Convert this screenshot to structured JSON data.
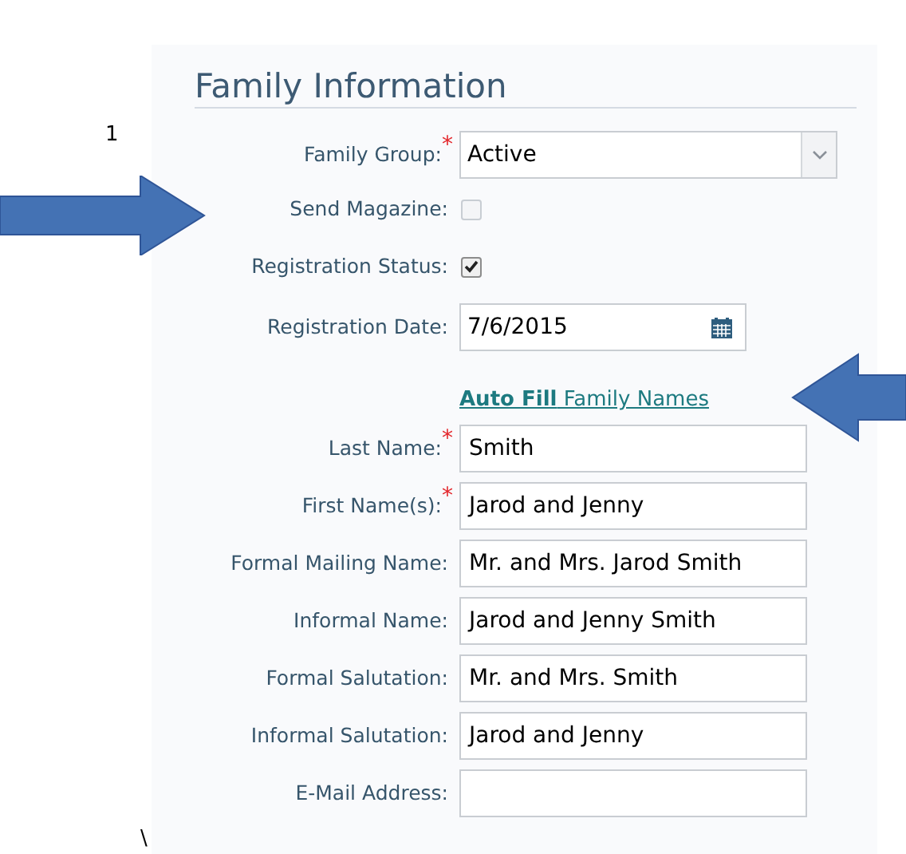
{
  "page_number": "1",
  "section_title": "Family Information",
  "fields": [
    {
      "kind": "select",
      "label": "Family Group:",
      "required_mark": "*",
      "value": "Active"
    },
    {
      "kind": "checkbox",
      "label": "Send Magazine:",
      "checked": false
    },
    {
      "kind": "checkbox",
      "label": "Registration Status:",
      "checked": true
    },
    {
      "kind": "date",
      "label": "Registration Date:",
      "value": "7/6/2015"
    },
    {
      "kind": "link",
      "bold": "Auto Fill",
      "text": "Family Names"
    },
    {
      "kind": "text",
      "label": "Last Name:",
      "required_mark": "*",
      "value": "Smith"
    },
    {
      "kind": "text",
      "label": "First Name(s):",
      "required_mark": "*",
      "value": "Jarod and Jenny"
    },
    {
      "kind": "text",
      "label": "Formal Mailing Name:",
      "value": "Mr. and Mrs. Jarod Smith"
    },
    {
      "kind": "text",
      "label": "Informal Name:",
      "value": "Jarod and Jenny Smith"
    },
    {
      "kind": "text",
      "label": "Formal Salutation:",
      "value": "Mr. and Mrs. Smith"
    },
    {
      "kind": "text",
      "label": "Informal Salutation:",
      "value": "Jarod and Jenny"
    },
    {
      "kind": "text",
      "label": "E-Mail Address:"
    }
  ],
  "stray_mark": "\\"
}
